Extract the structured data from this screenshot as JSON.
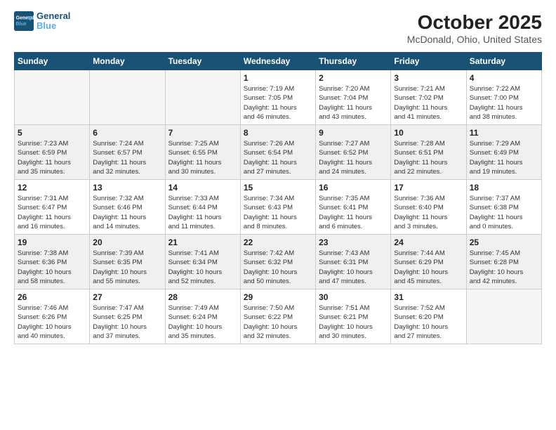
{
  "header": {
    "logo_line1": "General",
    "logo_line2": "Blue",
    "month_title": "October 2025",
    "location": "McDonald, Ohio, United States"
  },
  "weekdays": [
    "Sunday",
    "Monday",
    "Tuesday",
    "Wednesday",
    "Thursday",
    "Friday",
    "Saturday"
  ],
  "weeks": [
    [
      {
        "day": "",
        "info": ""
      },
      {
        "day": "",
        "info": ""
      },
      {
        "day": "",
        "info": ""
      },
      {
        "day": "1",
        "info": "Sunrise: 7:19 AM\nSunset: 7:05 PM\nDaylight: 11 hours\nand 46 minutes."
      },
      {
        "day": "2",
        "info": "Sunrise: 7:20 AM\nSunset: 7:04 PM\nDaylight: 11 hours\nand 43 minutes."
      },
      {
        "day": "3",
        "info": "Sunrise: 7:21 AM\nSunset: 7:02 PM\nDaylight: 11 hours\nand 41 minutes."
      },
      {
        "day": "4",
        "info": "Sunrise: 7:22 AM\nSunset: 7:00 PM\nDaylight: 11 hours\nand 38 minutes."
      }
    ],
    [
      {
        "day": "5",
        "info": "Sunrise: 7:23 AM\nSunset: 6:59 PM\nDaylight: 11 hours\nand 35 minutes."
      },
      {
        "day": "6",
        "info": "Sunrise: 7:24 AM\nSunset: 6:57 PM\nDaylight: 11 hours\nand 32 minutes."
      },
      {
        "day": "7",
        "info": "Sunrise: 7:25 AM\nSunset: 6:55 PM\nDaylight: 11 hours\nand 30 minutes."
      },
      {
        "day": "8",
        "info": "Sunrise: 7:26 AM\nSunset: 6:54 PM\nDaylight: 11 hours\nand 27 minutes."
      },
      {
        "day": "9",
        "info": "Sunrise: 7:27 AM\nSunset: 6:52 PM\nDaylight: 11 hours\nand 24 minutes."
      },
      {
        "day": "10",
        "info": "Sunrise: 7:28 AM\nSunset: 6:51 PM\nDaylight: 11 hours\nand 22 minutes."
      },
      {
        "day": "11",
        "info": "Sunrise: 7:29 AM\nSunset: 6:49 PM\nDaylight: 11 hours\nand 19 minutes."
      }
    ],
    [
      {
        "day": "12",
        "info": "Sunrise: 7:31 AM\nSunset: 6:47 PM\nDaylight: 11 hours\nand 16 minutes."
      },
      {
        "day": "13",
        "info": "Sunrise: 7:32 AM\nSunset: 6:46 PM\nDaylight: 11 hours\nand 14 minutes."
      },
      {
        "day": "14",
        "info": "Sunrise: 7:33 AM\nSunset: 6:44 PM\nDaylight: 11 hours\nand 11 minutes."
      },
      {
        "day": "15",
        "info": "Sunrise: 7:34 AM\nSunset: 6:43 PM\nDaylight: 11 hours\nand 8 minutes."
      },
      {
        "day": "16",
        "info": "Sunrise: 7:35 AM\nSunset: 6:41 PM\nDaylight: 11 hours\nand 6 minutes."
      },
      {
        "day": "17",
        "info": "Sunrise: 7:36 AM\nSunset: 6:40 PM\nDaylight: 11 hours\nand 3 minutes."
      },
      {
        "day": "18",
        "info": "Sunrise: 7:37 AM\nSunset: 6:38 PM\nDaylight: 11 hours\nand 0 minutes."
      }
    ],
    [
      {
        "day": "19",
        "info": "Sunrise: 7:38 AM\nSunset: 6:36 PM\nDaylight: 10 hours\nand 58 minutes."
      },
      {
        "day": "20",
        "info": "Sunrise: 7:39 AM\nSunset: 6:35 PM\nDaylight: 10 hours\nand 55 minutes."
      },
      {
        "day": "21",
        "info": "Sunrise: 7:41 AM\nSunset: 6:34 PM\nDaylight: 10 hours\nand 52 minutes."
      },
      {
        "day": "22",
        "info": "Sunrise: 7:42 AM\nSunset: 6:32 PM\nDaylight: 10 hours\nand 50 minutes."
      },
      {
        "day": "23",
        "info": "Sunrise: 7:43 AM\nSunset: 6:31 PM\nDaylight: 10 hours\nand 47 minutes."
      },
      {
        "day": "24",
        "info": "Sunrise: 7:44 AM\nSunset: 6:29 PM\nDaylight: 10 hours\nand 45 minutes."
      },
      {
        "day": "25",
        "info": "Sunrise: 7:45 AM\nSunset: 6:28 PM\nDaylight: 10 hours\nand 42 minutes."
      }
    ],
    [
      {
        "day": "26",
        "info": "Sunrise: 7:46 AM\nSunset: 6:26 PM\nDaylight: 10 hours\nand 40 minutes."
      },
      {
        "day": "27",
        "info": "Sunrise: 7:47 AM\nSunset: 6:25 PM\nDaylight: 10 hours\nand 37 minutes."
      },
      {
        "day": "28",
        "info": "Sunrise: 7:49 AM\nSunset: 6:24 PM\nDaylight: 10 hours\nand 35 minutes."
      },
      {
        "day": "29",
        "info": "Sunrise: 7:50 AM\nSunset: 6:22 PM\nDaylight: 10 hours\nand 32 minutes."
      },
      {
        "day": "30",
        "info": "Sunrise: 7:51 AM\nSunset: 6:21 PM\nDaylight: 10 hours\nand 30 minutes."
      },
      {
        "day": "31",
        "info": "Sunrise: 7:52 AM\nSunset: 6:20 PM\nDaylight: 10 hours\nand 27 minutes."
      },
      {
        "day": "",
        "info": ""
      }
    ]
  ]
}
